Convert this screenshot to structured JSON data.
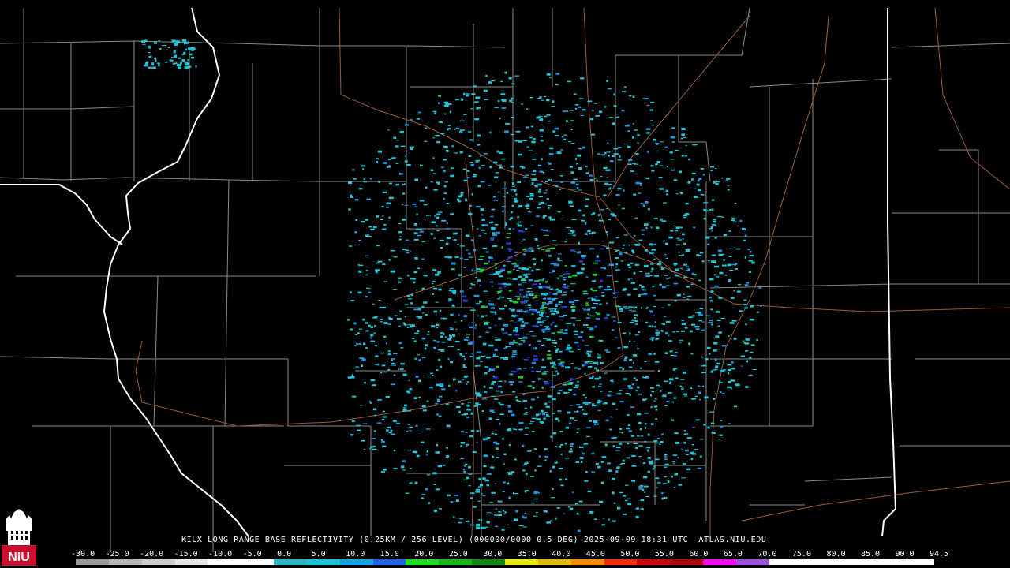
{
  "product": {
    "title": "KILX LONG RANGE BASE REFLECTIVITY (0.25KM / 256 LEVEL) (000000/0000 0.5 DEG) 2025-09-09 18:31 UTC  ATLAS.NIU.EDU",
    "radar_site": "KILX",
    "timestamp": "2025-09-09 18:31 UTC",
    "source": "ATLAS.NIU.EDU"
  },
  "logo": {
    "text": "NIU",
    "icon": "niu-tower-logo"
  },
  "colorbar": {
    "labels": [
      "-30.0",
      "-25.0",
      "-20.0",
      "-15.0",
      "-10.0",
      "-5.0",
      "0.0",
      "5.0",
      "10.0",
      "15.0",
      "20.0",
      "25.0",
      "30.0",
      "35.0",
      "40.0",
      "45.0",
      "50.0",
      "55.0",
      "60.0",
      "65.0",
      "70.0",
      "75.0",
      "80.0",
      "85.0",
      "90.0",
      "94.5"
    ],
    "colors": [
      "#9a9a9a",
      "#b4b4b4",
      "#cdcdcd",
      "#e6e6e6",
      "#ffffff",
      "#ffffff",
      "#2ab5c8",
      "#17c5e0",
      "#12a3e6",
      "#1e63ee",
      "#18e31a",
      "#12bb12",
      "#0a8a0a",
      "#eaea00",
      "#e6b800",
      "#ff8c00",
      "#ff2a00",
      "#d40000",
      "#b00000",
      "#ff00ff",
      "#a050e0",
      "#ffffff",
      "#ffffff",
      "#ffffff",
      "#ffffff",
      "#ffffff"
    ]
  },
  "colors": {
    "background": "#000000",
    "county_border": "#8a8a8a",
    "state_border": "#ffffff",
    "highway": "#9a5a3a",
    "echo_light": "#1ec8d8",
    "echo_mid": "#1e96e6",
    "echo_dark": "#2a3cd8",
    "echo_green": "#1ecc28"
  }
}
